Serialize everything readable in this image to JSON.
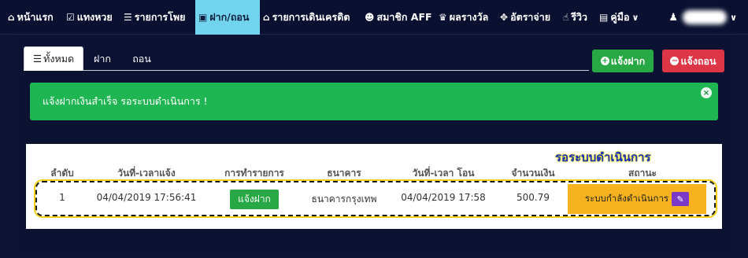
{
  "navbar": {
    "items": [
      {
        "icon": "home-icon",
        "glyph": "⌂",
        "label": "หน้าแรก"
      },
      {
        "icon": "checkbox-icon",
        "glyph": "☑",
        "label": "แทงหวย"
      },
      {
        "icon": "list-icon",
        "glyph": "☰",
        "label": "รายการโพย"
      },
      {
        "icon": "money-icon",
        "glyph": "▣",
        "label": "ฝาก/ถอน"
      },
      {
        "icon": "bank-icon",
        "glyph": "⌂",
        "label": "รายการเดินเครดิต"
      },
      {
        "icon": "users-icon",
        "glyph": "☻",
        "label": "สมาชิก AFF"
      },
      {
        "icon": "trophy-icon",
        "glyph": "♛",
        "label": "ผลรางวัล"
      },
      {
        "icon": "crosshair-icon",
        "glyph": "✥",
        "label": "อัตราจ่าย"
      },
      {
        "icon": "thumbs-up-icon",
        "glyph": "☝",
        "label": "รีวิว"
      },
      {
        "icon": "book-icon",
        "glyph": "▤",
        "label": "คู่มือ"
      }
    ],
    "manual_caret": "∨",
    "user_glyph": "♟",
    "user_caret": "∨"
  },
  "tabs": [
    {
      "glyph": "☰",
      "label": "ทั้งหมด"
    },
    {
      "label": "ฝาก"
    },
    {
      "label": "ถอน"
    }
  ],
  "buttons": {
    "deposit_notify": "แจ้งฝาก",
    "deposit_glyph": "+",
    "withdraw_notify": "แจ้งถอน",
    "withdraw_glyph": "−"
  },
  "alert": {
    "message": "แจ้งฝากเงินสำเร็จ รอระบบดำเนินการ !",
    "close_glyph": "×"
  },
  "callout": "รอระบบดำเนินการ",
  "table": {
    "headers": [
      "ลำดับ",
      "วันที่-เวลาแจ้ง",
      "การทำรายการ",
      "ธนาคาร",
      "วันที่-เวลา โอน",
      "จำนวนเงิน",
      "สถานะ"
    ],
    "rows": [
      {
        "index": "1",
        "notify_time": "04/04/2019 17:56:41",
        "type": "แจ้งฝาก",
        "bank": "ธนาคารกรุงเทพ",
        "transfer_time": "04/04/2019 17:58",
        "amount": "500.79",
        "status": "ระบบกำลังดำเนินการ",
        "edit_glyph": "✎"
      }
    ]
  },
  "colors": {
    "background": "#0d1433",
    "nav_active": "#73d4ef",
    "success": "#28a745",
    "danger": "#dc3545",
    "status_pending": "#f7b31f",
    "edit_button": "#7b38c8"
  }
}
